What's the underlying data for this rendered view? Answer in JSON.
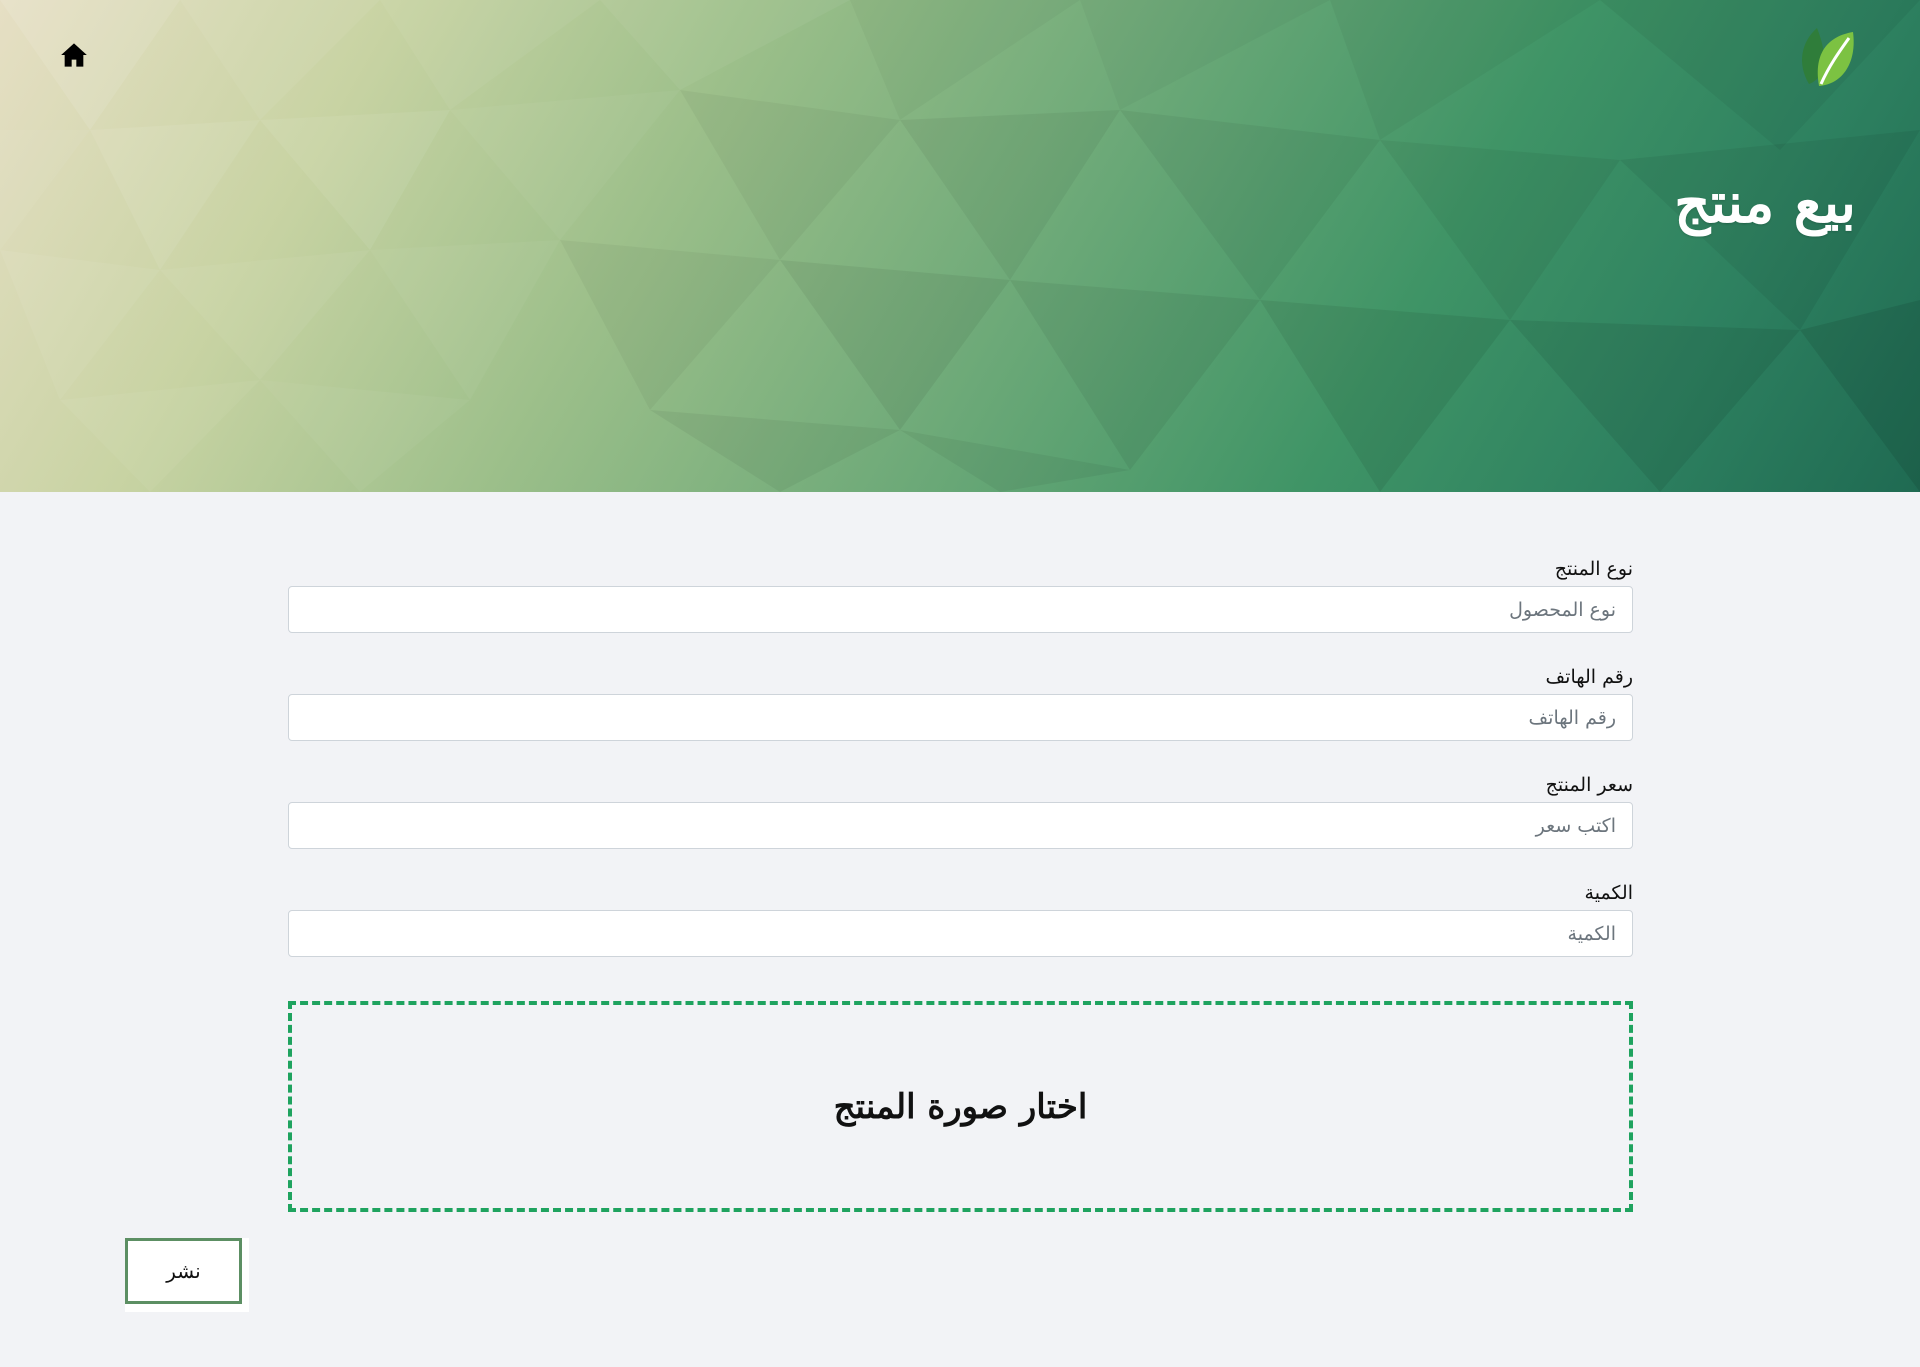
{
  "colors": {
    "accent": "#1fa35f",
    "button_border": "#5c8f63",
    "page_background": "#f2f3f6",
    "hero_dark": "#1f6a52",
    "hero_light": "#e6dfc4"
  },
  "header": {
    "home_icon": "home-icon",
    "logo_icon": "leaf-logo-icon",
    "title": "بيع منتج"
  },
  "form": {
    "product_type": {
      "label": "نوع المنتج",
      "placeholder": "نوع المحصول",
      "value": ""
    },
    "phone": {
      "label": "رقم الهاتف",
      "placeholder": "رقم الهاتف",
      "value": ""
    },
    "price": {
      "label": "سعر المنتج",
      "placeholder": "اكتب سعر",
      "value": ""
    },
    "quantity": {
      "label": "الكمية",
      "placeholder": "الكمية",
      "value": ""
    },
    "image_picker": {
      "label": "اختار صورة المنتج"
    },
    "publish_label": "نشر"
  }
}
